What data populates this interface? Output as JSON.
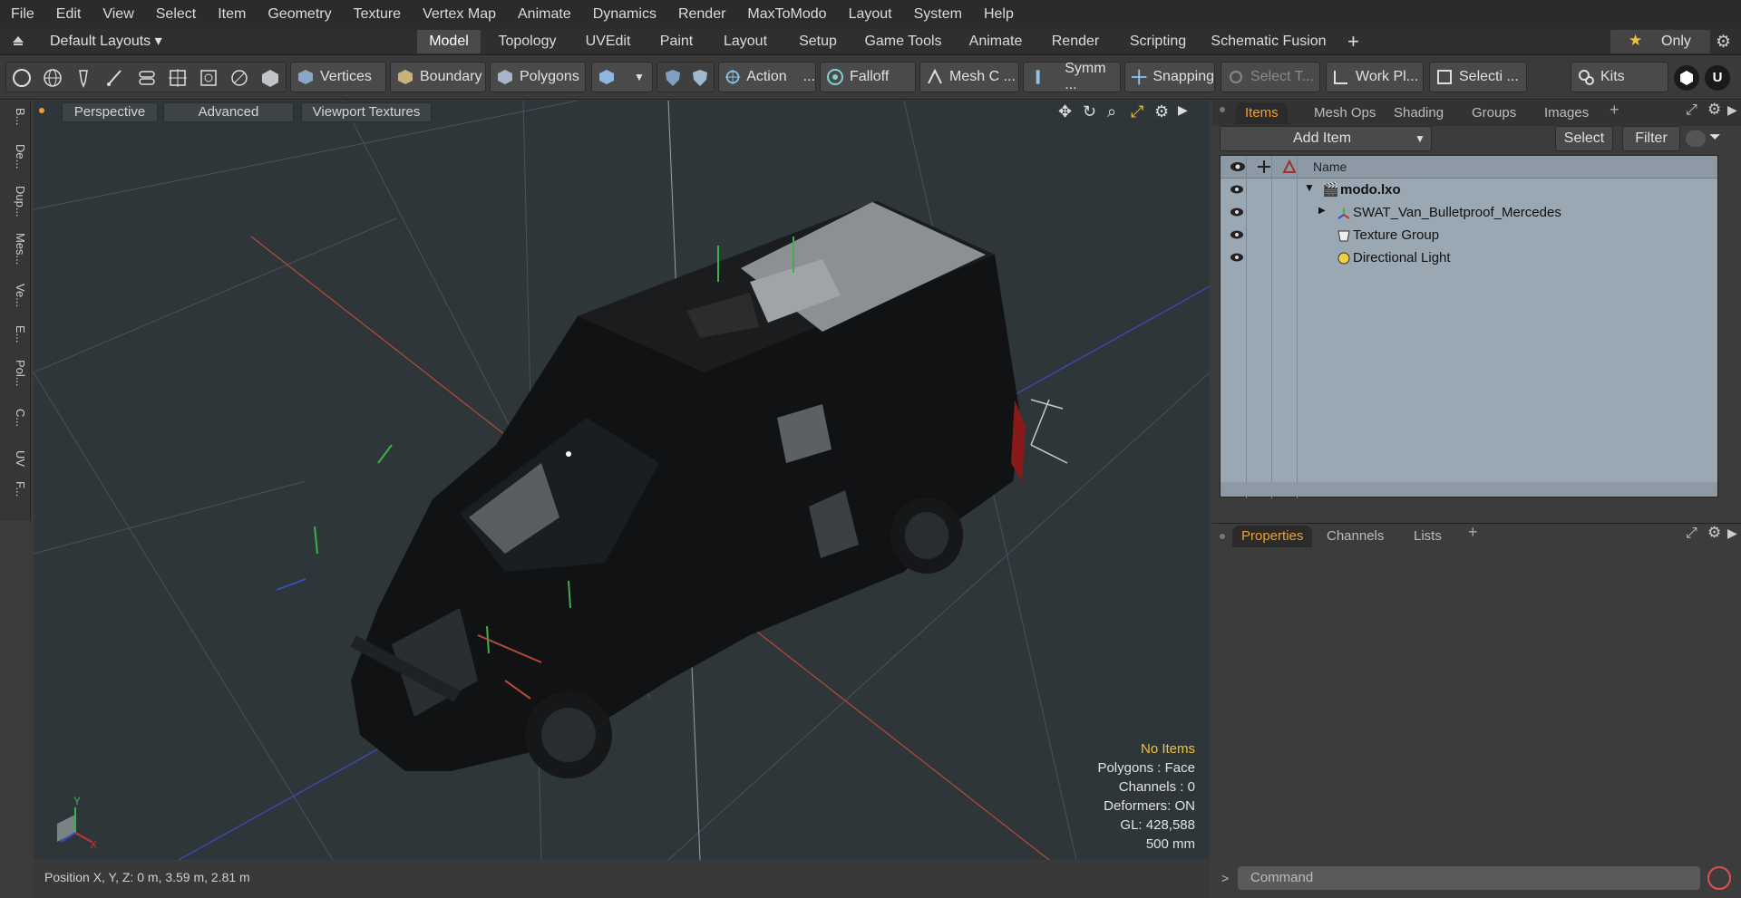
{
  "menu": [
    "File",
    "Edit",
    "View",
    "Select",
    "Item",
    "Geometry",
    "Texture",
    "Vertex Map",
    "Animate",
    "Dynamics",
    "Render",
    "MaxToModo",
    "Layout",
    "System",
    "Help"
  ],
  "layout_selector": "Default Layouts ▾",
  "layout_tabs": [
    "Model",
    "Topology",
    "UVEdit",
    "Paint",
    "Layout",
    "Setup",
    "Game Tools",
    "Animate",
    "Render",
    "Scripting",
    "Schematic Fusion"
  ],
  "only_label": "Only",
  "toolbar": {
    "vertices": "Vertices",
    "boundary": "Boundary",
    "polygons": "Polygons",
    "action": "Action",
    "falloff": "Falloff",
    "mesh": "Mesh C ...",
    "symm": "Symm ...",
    "snapping": "Snapping",
    "select_t": "Select T...",
    "workpl": "Work Pl...",
    "selecti": "Selecti ...",
    "kits": "Kits"
  },
  "left_strip": [
    "B...",
    "De...",
    "Dup...",
    "Mes...",
    "Ve...",
    "E...",
    "Pol...",
    "C...",
    "UV",
    "F..."
  ],
  "viewport": {
    "perspective": "Perspective",
    "advanced": "Advanced",
    "textures": "Viewport Textures",
    "info": {
      "no_items": "No Items",
      "polygons": "Polygons : Face",
      "channels": "Channels : 0",
      "deformers": "Deformers: ON",
      "gl": "GL: 428,588",
      "scale": "500 mm"
    },
    "axis_y": "Y",
    "axis_x": "X"
  },
  "status": "Position X, Y, Z:   0 m, 3.59 m, 2.81 m",
  "items_panel": {
    "tabs": [
      "Items",
      "Mesh Ops",
      "Shading",
      "Groups",
      "Images"
    ],
    "add_item": "Add Item",
    "select": "Select",
    "filter": "Filter",
    "col_name": "Name",
    "tree": [
      {
        "label": "modo.lxo",
        "bold": true
      },
      {
        "label": "SWAT_Van_Bulletproof_Mercedes"
      },
      {
        "label": "Texture Group"
      },
      {
        "label": "Directional Light"
      }
    ]
  },
  "props_panel": {
    "tabs": [
      "Properties",
      "Channels",
      "Lists"
    ]
  },
  "command": {
    "placeholder": "Command"
  },
  "colors": {
    "accent": "#f0a030",
    "tree_bg": "#9aa8b3",
    "viewport_bg": "#2f363a"
  }
}
